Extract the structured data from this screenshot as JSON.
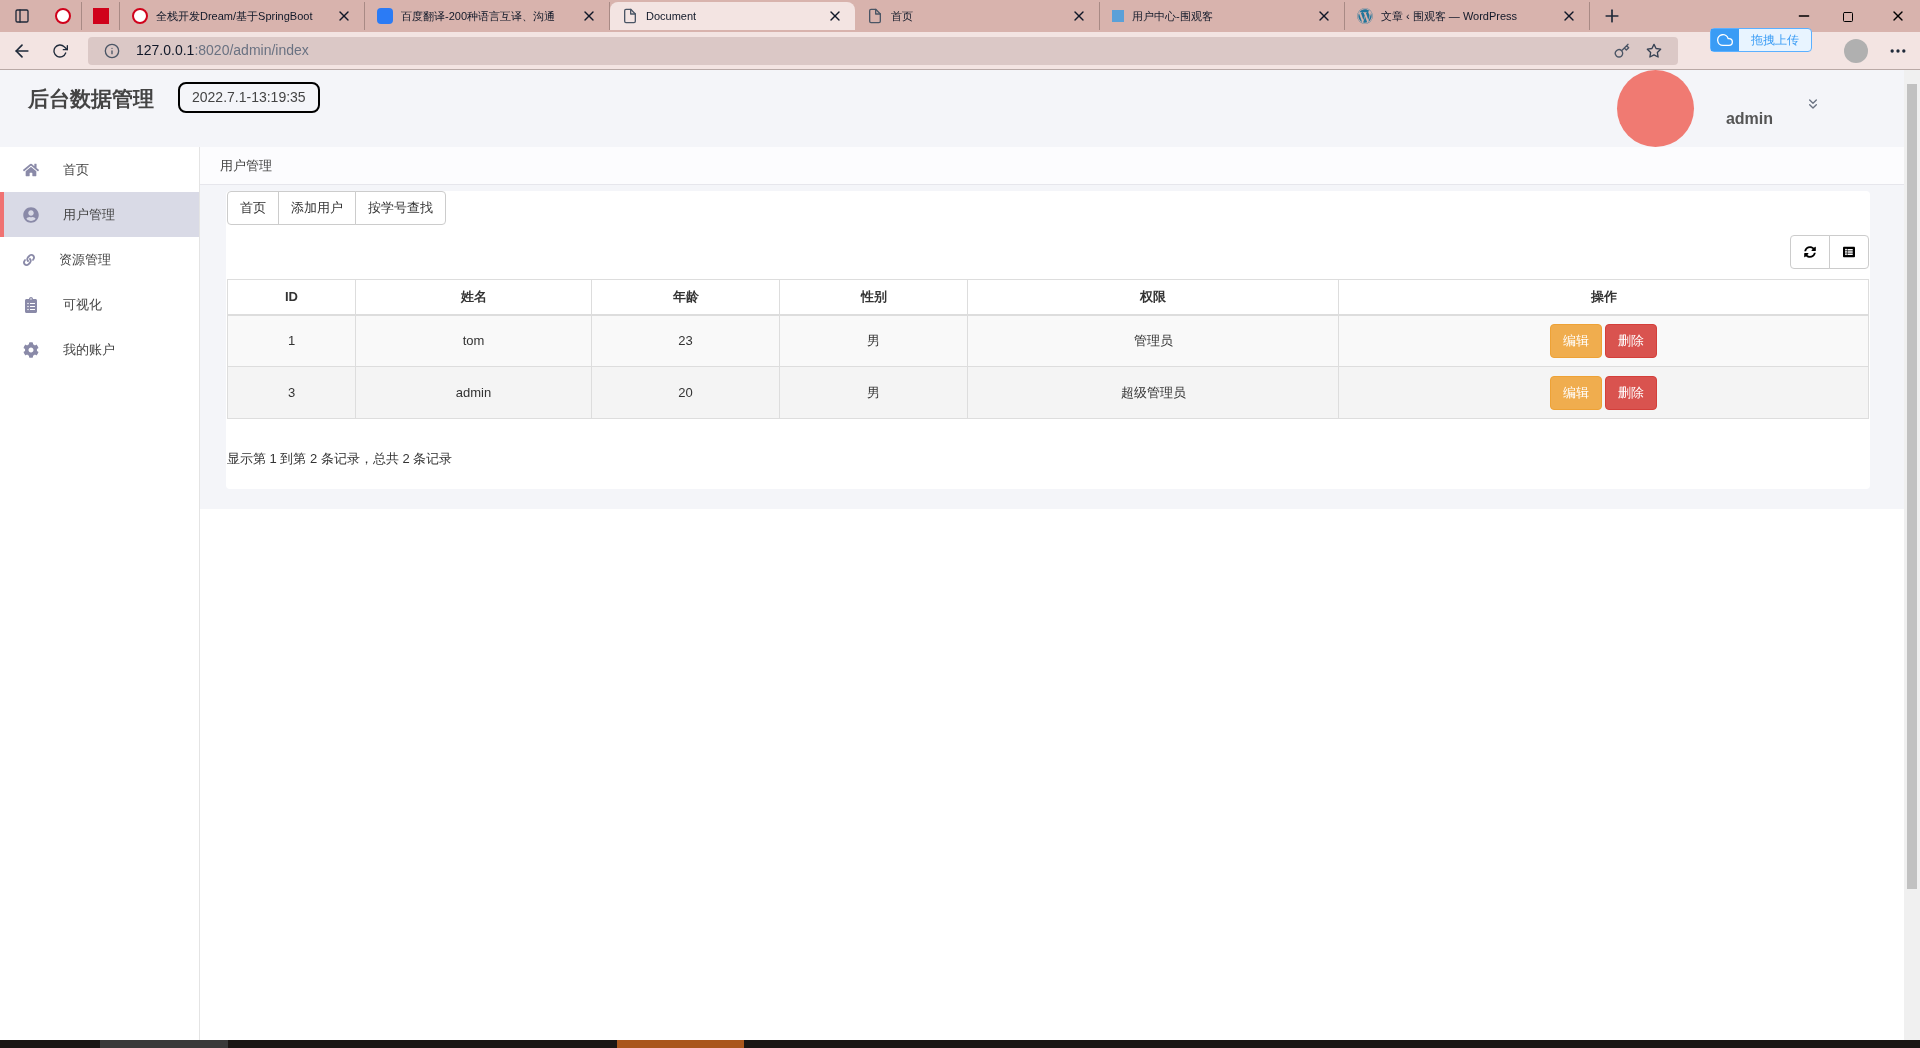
{
  "browser": {
    "tabs": [
      {
        "selected": false
      },
      {
        "selected": false
      },
      {
        "title": "全栈开发Dream/基于SpringBoot",
        "selected": false
      },
      {
        "title": "百度翻译-200种语言互译、沟通",
        "selected": false
      },
      {
        "title": "Document",
        "selected": true
      },
      {
        "title": "首页",
        "selected": false
      },
      {
        "title": "用户中心-围观客",
        "selected": false
      },
      {
        "title": "文章 ‹ 围观客 — WordPress",
        "selected": false
      }
    ],
    "url_host": "127.0.0.1",
    "url_rest": ":8020/admin/index",
    "upload_popup": "拖拽上传"
  },
  "header": {
    "title": "后台数据管理",
    "clock": "2022.7.1-13:19:35",
    "user": "admin"
  },
  "sidebar": {
    "items": [
      {
        "label": "首页",
        "selected": false
      },
      {
        "label": "用户管理",
        "selected": true
      },
      {
        "label": "资源管理",
        "selected": false
      },
      {
        "label": "可视化",
        "selected": false
      },
      {
        "label": "我的账户",
        "selected": false
      }
    ]
  },
  "breadcrumb": "用户管理",
  "toolbar": [
    "首页",
    "添加用户",
    "按学号查找"
  ],
  "table": {
    "columns": [
      "ID",
      "姓名",
      "年龄",
      "性别",
      "权限",
      "操作"
    ],
    "rows": [
      {
        "cells": [
          "1",
          "tom",
          "23",
          "男",
          "管理员"
        ],
        "actions": [
          "编辑",
          "删除"
        ]
      },
      {
        "cells": [
          "3",
          "admin",
          "20",
          "男",
          "超级管理员"
        ],
        "actions": [
          "编辑",
          "删除"
        ]
      }
    ]
  },
  "pagination": "显示第 1 到第 2 条记录，总共 2 条记录"
}
